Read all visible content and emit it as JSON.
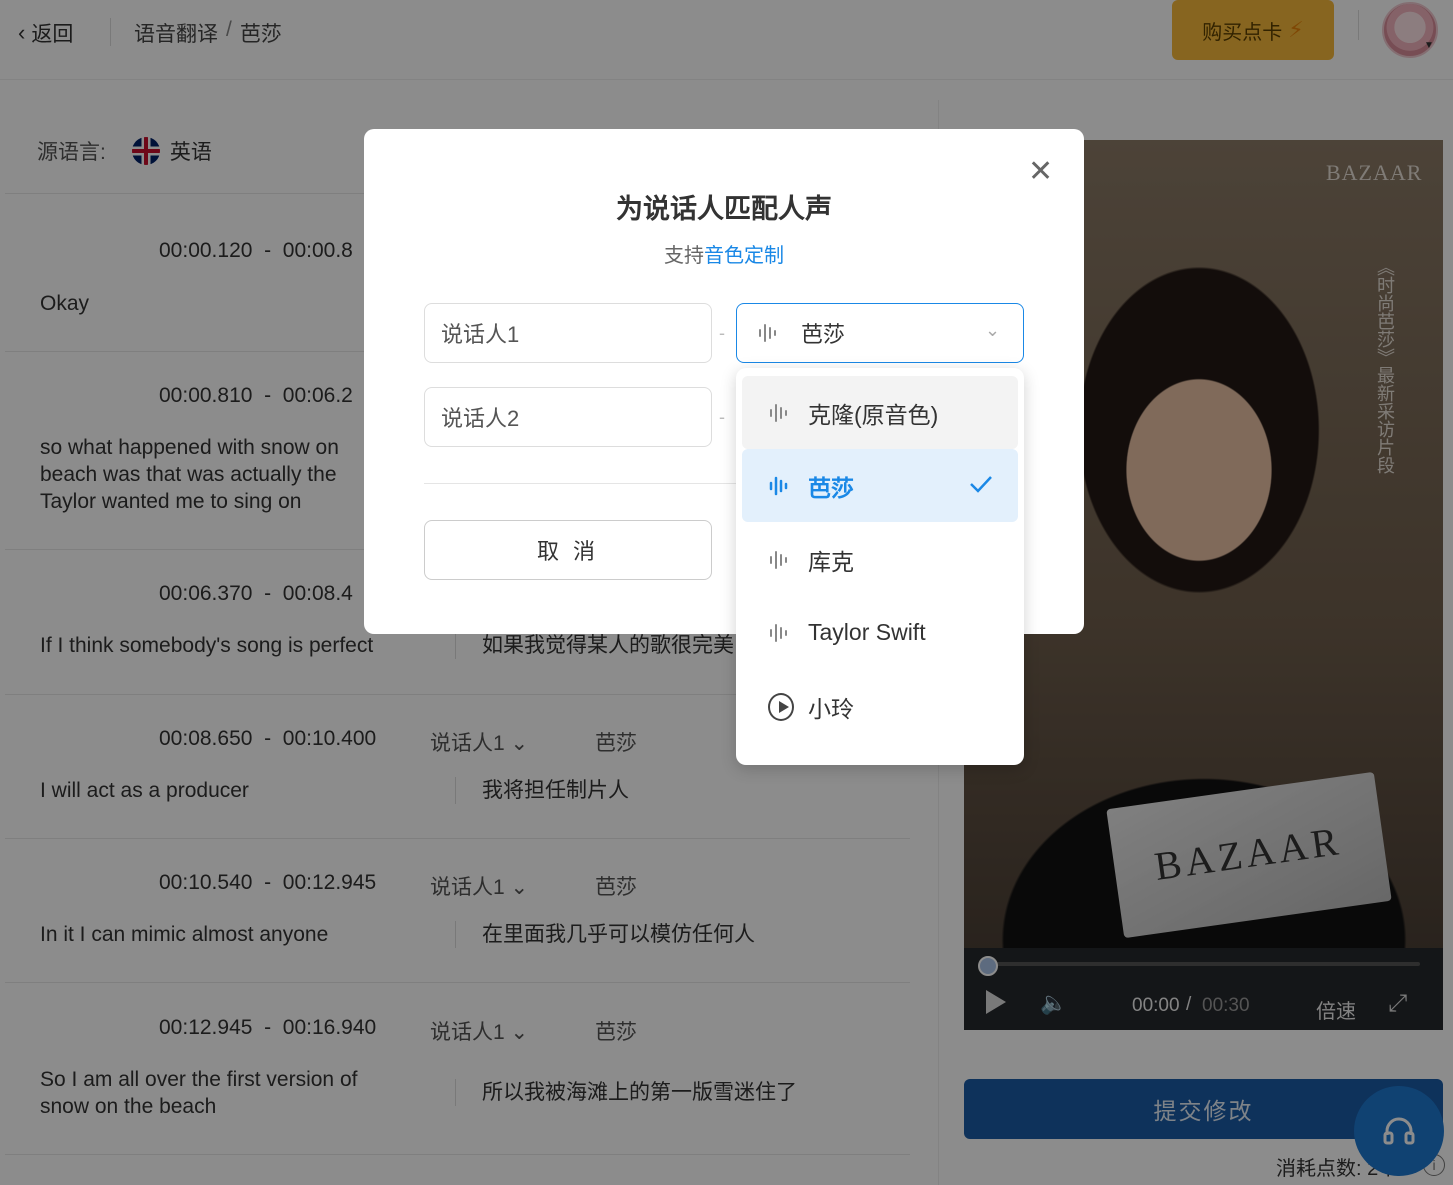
{
  "header": {
    "back_label": "返回",
    "breadcrumb": [
      "语音翻译",
      "/",
      "芭莎"
    ],
    "buy_label": "购买点卡"
  },
  "source": {
    "label": "源语言:",
    "language": "英语"
  },
  "segments": [
    {
      "start": "00:00.120",
      "end": "00:00.8",
      "speaker": "",
      "voice": "",
      "en": "Okay",
      "zh": ""
    },
    {
      "start": "00:00.810",
      "end": "00:06.2",
      "speaker": "",
      "voice": "",
      "en": "so what happened with snow on beach was that was actually the Taylor wanted me to sing on",
      "zh": ""
    },
    {
      "start": "00:06.370",
      "end": "00:08.4",
      "speaker": "",
      "voice": "",
      "en": "If I think somebody's song is perfect",
      "zh": "如果我觉得某人的歌很完美"
    },
    {
      "start": "00:08.650",
      "end": "00:10.400",
      "speaker": "说话人1",
      "voice": "芭莎",
      "en": "I will act as a producer",
      "zh": "我将担任制片人"
    },
    {
      "start": "00:10.540",
      "end": "00:12.945",
      "speaker": "说话人1",
      "voice": "芭莎",
      "en": "In it I can mimic almost anyone",
      "zh": "在里面我几乎可以模仿任何人"
    },
    {
      "start": "00:12.945",
      "end": "00:16.940",
      "speaker": "说话人1",
      "voice": "芭莎",
      "en": "So I am all over the first version of snow on the beach",
      "zh": "所以我被海滩上的第一版雪迷住了"
    }
  ],
  "video": {
    "brand": "BAZAAR",
    "side_text": "《时尚芭莎》最新采访片段",
    "magazine_text": "BAZAAR",
    "current_time": "00:00",
    "separator": "/",
    "duration": "00:30",
    "speed_label": "倍速",
    "progress": 0
  },
  "submit_label": "提交修改",
  "cost_label": "消耗点数: 2个",
  "modal": {
    "title": "为说话人匹配人声",
    "subtitle_prefix": "支持",
    "subtitle_link": "音色定制",
    "speaker1": "说话人1",
    "speaker2": "说话人2",
    "dash": "-",
    "selected_voice": "芭莎",
    "cancel_label": "取 消"
  },
  "dropdown": {
    "options": [
      {
        "label": "克隆(原音色)",
        "icon": "waveform-icon",
        "state": "hover"
      },
      {
        "label": "芭莎",
        "icon": "waveform-icon",
        "state": "selected"
      },
      {
        "label": "库克",
        "icon": "waveform-icon",
        "state": "normal"
      },
      {
        "label": "Taylor Swift",
        "icon": "waveform-icon",
        "state": "normal"
      },
      {
        "label": "小玲",
        "icon": "play-circle-icon",
        "state": "normal"
      }
    ]
  },
  "colors": {
    "accent": "#1a88e6",
    "buy": "#f6b93b",
    "submit": "#1a5ba6"
  }
}
